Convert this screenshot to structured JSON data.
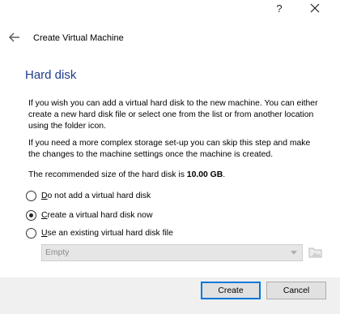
{
  "window": {
    "help_label": "?",
    "close_icon": "close-icon"
  },
  "header": {
    "back_icon": "back-arrow-icon",
    "title": "Create Virtual Machine"
  },
  "page": {
    "title": "Hard disk",
    "para1": "If you wish you can add a virtual hard disk to the new machine. You can either create a new hard disk file or select one from the list or from another location using the folder icon.",
    "para2": "If you need a more complex storage set-up you can skip this step and make the changes to the machine settings once the machine is created.",
    "recommended_prefix": "The recommended size of the hard disk is ",
    "recommended_value": "10.00 GB",
    "recommended_suffix": "."
  },
  "options": [
    {
      "label": "Do not add a virtual hard disk",
      "mnemonic": "D",
      "rest": "o not add a virtual hard disk",
      "checked": false
    },
    {
      "label": "Create a virtual hard disk now",
      "mnemonic": "C",
      "rest": "reate a virtual hard disk now",
      "checked": true
    },
    {
      "label": "Use an existing virtual hard disk file",
      "mnemonic": "U",
      "rest": "se an existing virtual hard disk file",
      "checked": false
    }
  ],
  "disk_select": {
    "value": "Empty",
    "enabled": false
  },
  "footer": {
    "create_label": "Create",
    "cancel_label": "Cancel"
  },
  "colors": {
    "title_blue": "#1e3c8c",
    "footer_bg": "#f0f0f0",
    "default_button_border": "#0078d7"
  }
}
